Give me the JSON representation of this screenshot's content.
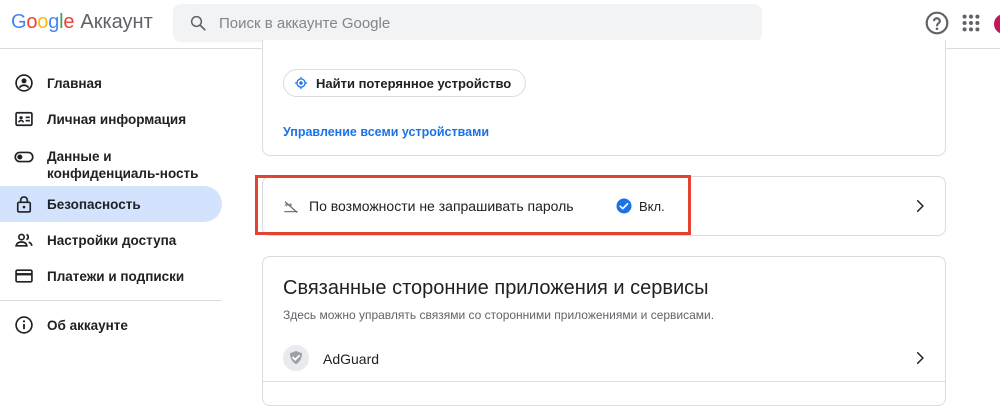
{
  "header": {
    "logo_text": "Google",
    "product_name": "Аккаунт",
    "search_placeholder": "Поиск в аккаунте Google",
    "help_icon": "help-circle-icon",
    "apps_icon": "apps-grid-icon"
  },
  "sidebar": {
    "items": [
      {
        "label": "Главная",
        "icon": "account-circle-icon"
      },
      {
        "label": "Личная информация",
        "icon": "id-card-icon"
      },
      {
        "label": "Данные и конфиденциаль-ность",
        "icon": "toggle-icon"
      },
      {
        "label": "Безопасность",
        "icon": "lock-icon",
        "active": true
      },
      {
        "label": "Настройки доступа",
        "icon": "people-icon"
      },
      {
        "label": "Платежи и подписки",
        "icon": "credit-card-icon"
      },
      {
        "label": "Об аккаунте",
        "icon": "info-icon"
      }
    ]
  },
  "devices_card": {
    "chip_label": "Найти потерянное устройство",
    "manage_link": "Управление всеми устройствами"
  },
  "passkey_card": {
    "label": "По возможности не запрашивать пароль",
    "status": "Вкл."
  },
  "apps_card": {
    "title": "Связанные сторонние приложения и сервисы",
    "description": "Здесь можно управлять связями со сторонними приложениями и сервисами.",
    "apps": [
      {
        "name": "AdGuard"
      }
    ]
  },
  "colors": {
    "accent": "#1a73e8",
    "active_nav_bg": "#d3e3fd",
    "highlight_border": "#e44332"
  }
}
